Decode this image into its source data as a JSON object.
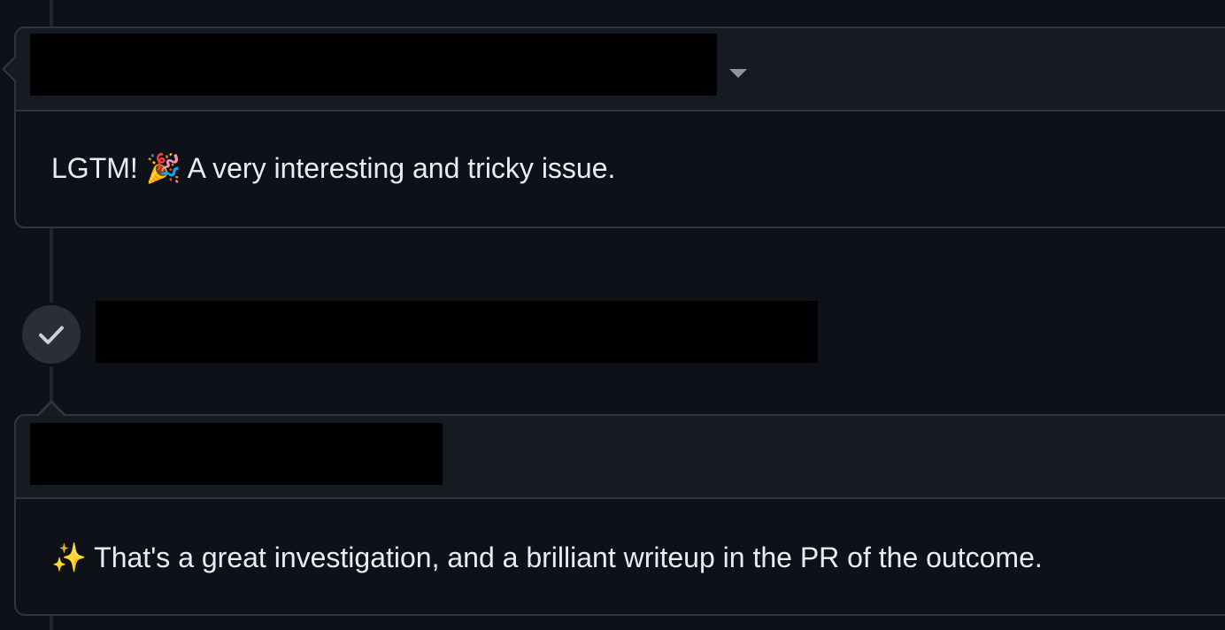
{
  "timeline": {
    "comments": [
      {
        "author_redacted": true,
        "emoji": "🎉",
        "body_before": "LGTM! ",
        "body_after": " A very interesting and tricky issue.",
        "menu_icon": "chevron-down-icon"
      },
      {
        "author_redacted": true,
        "emoji": "✨",
        "body_before": "",
        "body_after": " That's a great investigation, and a brilliant writeup in the PR of the outcome."
      }
    ],
    "review_event": {
      "icon": "check-icon",
      "text_redacted": true
    }
  },
  "colors": {
    "background": "#0e1117",
    "header": "#161b22",
    "border": "#30363d",
    "text": "#e6edf3",
    "muted": "#8b949e",
    "badge": "#2a2e36"
  }
}
